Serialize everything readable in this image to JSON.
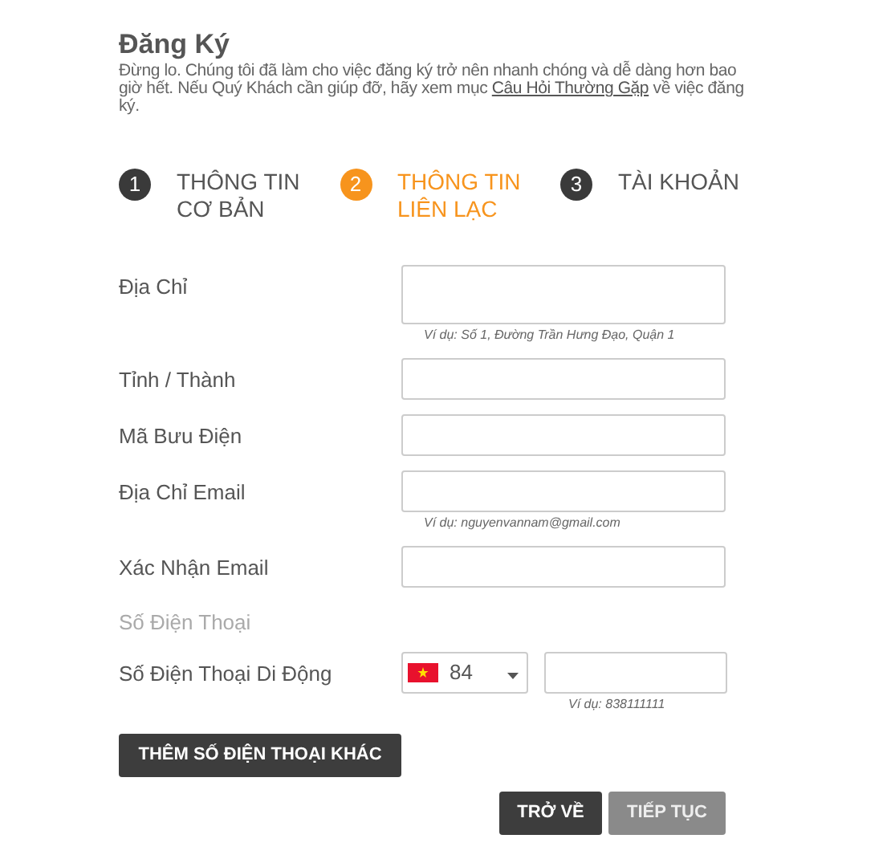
{
  "title": "Đăng Ký",
  "intro": {
    "before": "Đừng lo. Chúng tôi đã làm cho việc đăng ký trở nên nhanh chóng và dễ dàng hơn bao giờ hết. Nếu Quý Khách cần giúp đỡ, hãy xem mục ",
    "link": "Câu Hỏi Thường Gặp",
    "after": " về việc đăng ký."
  },
  "steps": [
    {
      "number": "1",
      "label": "THÔNG TIN CƠ BẢN",
      "selected": false
    },
    {
      "number": "2",
      "label": "THÔNG TIN LIÊN LẠC",
      "selected": true
    },
    {
      "number": "3",
      "label": "TÀI KHOẢN",
      "selected": false
    }
  ],
  "fields": [
    {
      "kind": "textarea",
      "label": "Địa Chỉ",
      "hint": "Ví dụ: Số 1, Đường Trần Hưng Đạo, Quận 1"
    },
    {
      "kind": "text",
      "label": "Tỉnh / Thành"
    },
    {
      "kind": "text",
      "label": "Mã Bưu Điện"
    },
    {
      "kind": "text",
      "label": "Địa Chỉ Email",
      "hint": "Ví dụ: nguyenvannam@gmail.com"
    },
    {
      "kind": "text",
      "label": "Xác Nhận Email"
    },
    {
      "kind": "section",
      "label": "Số Điện Thoại"
    },
    {
      "kind": "phone",
      "label": "Số Điện Thoại Di Động",
      "code": "84",
      "hint": "Ví dụ: 838111111"
    }
  ],
  "add_button": {
    "label": "THÊM SỐ ĐIỆN THOẠI KHÁC",
    "disabled": false
  },
  "nav_buttons": [
    {
      "label": "TRỞ VỀ",
      "disabled": false
    },
    {
      "label": "TIẾP TỤC",
      "disabled": true
    }
  ]
}
